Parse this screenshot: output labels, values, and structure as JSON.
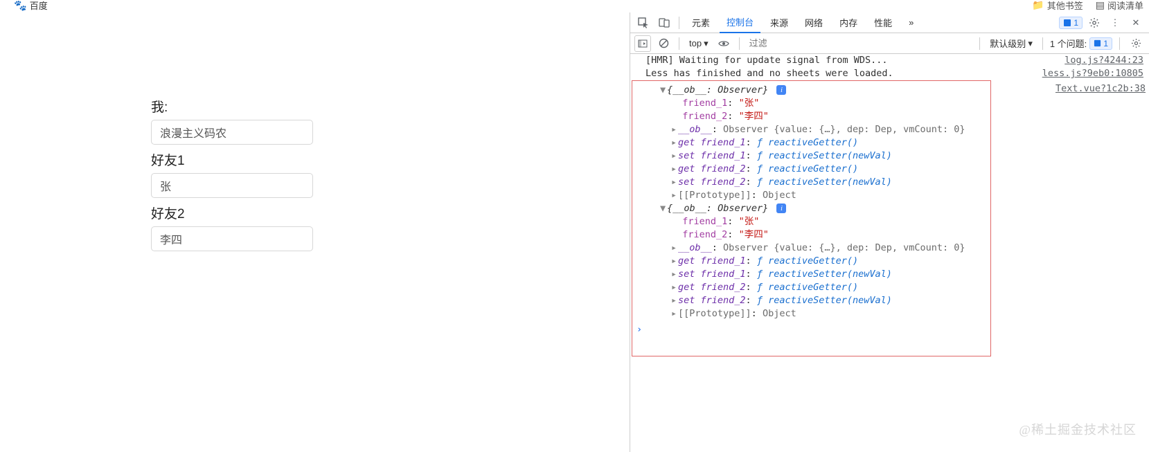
{
  "browser": {
    "site_name": "百度",
    "bookmark_folder": "其他书签",
    "reading_list": "阅读清单"
  },
  "form": {
    "me_label": "我:",
    "me_value": "浪漫主义码农",
    "friend1_label": "好友1",
    "friend1_value": "张",
    "friend2_label": "好友2",
    "friend2_value": "李四"
  },
  "devtools": {
    "tabs": {
      "elements": "元素",
      "console": "控制台",
      "sources": "来源",
      "network": "网络",
      "memory": "内存",
      "performance": "性能",
      "more": "»"
    },
    "issue_count": "1",
    "subbar": {
      "context": "top",
      "filter_placeholder": "过滤",
      "level": "默认级别",
      "issues_label": "1 个问题:",
      "issues_count": "1"
    },
    "logs": {
      "hmr": "[HMR] Waiting for update signal from WDS...",
      "hmr_src": "log.js?4244:23",
      "less": "Less has finished and no sheets were loaded.",
      "less_src": "less.js?9eb0:10805",
      "text_src": "Text.vue?1c2b:38"
    },
    "object": {
      "head": "{__ob__: Observer}",
      "friend1_key": "friend_1",
      "friend1_val": "\"张\"",
      "friend2_key": "friend_2",
      "friend2_val": "\"李四\"",
      "ob_line": "__ob__",
      "ob_val": "Observer {value: {…}, dep: Dep, vmCount: 0}",
      "get_f1": "get friend_1",
      "set_f1": "set friend_1",
      "get_f2": "get friend_2",
      "set_f2": "set friend_2",
      "reactive_getter": "ƒ reactiveGetter()",
      "reactive_setter": "ƒ reactiveSetter(newVal)",
      "proto_key": "[[Prototype]]",
      "proto_val": "Object"
    }
  },
  "watermark": "@稀土掘金技术社区"
}
